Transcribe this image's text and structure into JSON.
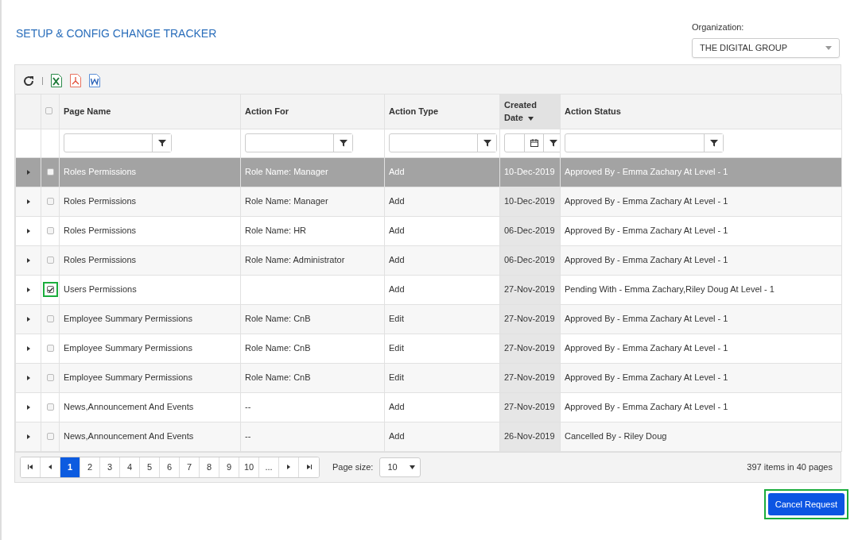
{
  "title": "SETUP & CONFIG CHANGE TRACKER",
  "organization": {
    "label": "Organization:",
    "value": "THE DIGITAL GROUP"
  },
  "grid": {
    "columns": [
      {
        "label": "Page Name",
        "sorted": false,
        "kind": "text"
      },
      {
        "label": "Action For",
        "sorted": false,
        "kind": "text"
      },
      {
        "label": "Action Type",
        "sorted": false,
        "kind": "text"
      },
      {
        "label": "Created Date",
        "sorted": true,
        "kind": "date"
      },
      {
        "label": "Action Status",
        "sorted": false,
        "kind": "wide"
      }
    ],
    "header_checked": false,
    "rows": [
      {
        "selected": true,
        "checked": false,
        "outlined": false,
        "cells": [
          "Roles Permissions",
          "Role Name: Manager",
          "Add",
          "10-Dec-2019",
          "Approved By - Emma Zachary At Level - 1"
        ]
      },
      {
        "selected": false,
        "checked": false,
        "outlined": false,
        "cells": [
          "Roles Permissions",
          "Role Name: Manager",
          "Add",
          "10-Dec-2019",
          "Approved By - Emma Zachary At Level - 1"
        ]
      },
      {
        "selected": false,
        "checked": false,
        "outlined": false,
        "cells": [
          "Roles Permissions",
          "Role Name: HR",
          "Add",
          "06-Dec-2019",
          "Approved By - Emma Zachary At Level - 1"
        ]
      },
      {
        "selected": false,
        "checked": false,
        "outlined": false,
        "cells": [
          "Roles Permissions",
          "Role Name: Administrator",
          "Add",
          "06-Dec-2019",
          "Approved By - Emma Zachary At Level - 1"
        ]
      },
      {
        "selected": false,
        "checked": true,
        "outlined": true,
        "cells": [
          "Users Permissions",
          "",
          "Add",
          "27-Nov-2019",
          "Pending With - Emma Zachary,Riley Doug At Level - 1"
        ]
      },
      {
        "selected": false,
        "checked": false,
        "outlined": false,
        "cells": [
          "Employee Summary Permissions",
          "Role Name: CnB",
          "Edit",
          "27-Nov-2019",
          "Approved By - Emma Zachary At Level - 1"
        ]
      },
      {
        "selected": false,
        "checked": false,
        "outlined": false,
        "cells": [
          "Employee Summary Permissions",
          "Role Name: CnB",
          "Edit",
          "27-Nov-2019",
          "Approved By - Emma Zachary At Level - 1"
        ]
      },
      {
        "selected": false,
        "checked": false,
        "outlined": false,
        "cells": [
          "Employee Summary Permissions",
          "Role Name: CnB",
          "Edit",
          "27-Nov-2019",
          "Approved By - Emma Zachary At Level - 1"
        ]
      },
      {
        "selected": false,
        "checked": false,
        "outlined": false,
        "cells": [
          "News,Announcement And Events",
          "--",
          "Add",
          "27-Nov-2019",
          "Approved By - Emma Zachary At Level - 1"
        ]
      },
      {
        "selected": false,
        "checked": false,
        "outlined": false,
        "cells": [
          "News,Announcement And Events",
          "--",
          "Add",
          "26-Nov-2019",
          "Cancelled By - Riley Doug"
        ]
      }
    ],
    "pager": {
      "pages": [
        {
          "label": "1",
          "selected": true
        },
        {
          "label": "2",
          "selected": false
        },
        {
          "label": "3",
          "selected": false
        },
        {
          "label": "4",
          "selected": false
        },
        {
          "label": "5",
          "selected": false
        },
        {
          "label": "6",
          "selected": false
        },
        {
          "label": "7",
          "selected": false
        },
        {
          "label": "8",
          "selected": false
        },
        {
          "label": "9",
          "selected": false
        },
        {
          "label": "10",
          "selected": false
        },
        {
          "label": "...",
          "selected": false
        }
      ],
      "page_size_label": "Page size:",
      "page_size": "10",
      "info": "397 items in 40 pages"
    }
  },
  "cancel_button": {
    "label": "Cancel Request",
    "outlined": true
  }
}
